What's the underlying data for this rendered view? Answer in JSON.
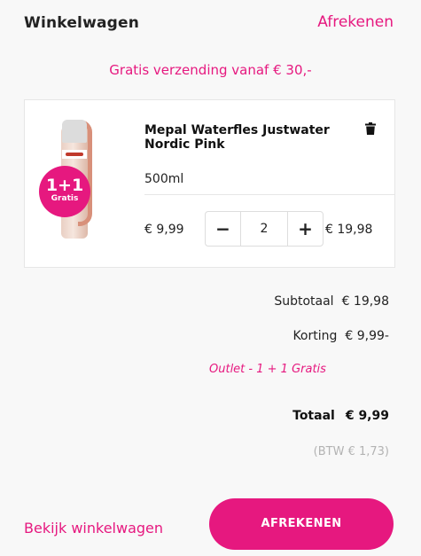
{
  "header": {
    "title": "Winkelwagen",
    "checkout_link": "Afrekenen"
  },
  "shipping_note": "Gratis verzending vanaf € 30,-",
  "cart_item": {
    "name": "Mepal Waterfles Justwater Nordic Pink",
    "variant": "500ml",
    "unit_price": "€ 9,99",
    "quantity": "2",
    "line_total": "€ 19,98",
    "promo_badge_main": "1+1",
    "promo_badge_sub": "Gratis",
    "minus_icon": "−",
    "plus_icon": "+",
    "trash_icon": "trash-icon"
  },
  "summary": {
    "subtotal_label": "Subtotaal",
    "subtotal_value": "€ 19,98",
    "discount_label": "Korting",
    "discount_value": "€ 9,99-",
    "discount_note": "Outlet - 1 + 1 Gratis",
    "total_label": "Totaal",
    "total_value": "€ 9,99",
    "tax": "(BTW € 1,73)"
  },
  "footer": {
    "view_cart": "Bekijk winkelwagen",
    "checkout_button": "AFREKENEN"
  },
  "colors": {
    "accent": "#e6187f",
    "background": "#f8f8f8"
  }
}
